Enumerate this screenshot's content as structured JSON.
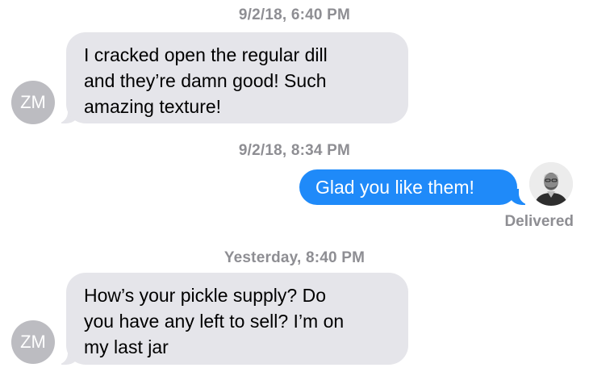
{
  "conversation": {
    "messages": [
      {
        "timestamp": "9/2/18, 6:40 PM",
        "sender_initials": "ZM",
        "lines": [
          "I cracked open the regular dill",
          "and they’re damn good! Such",
          "amazing texture!"
        ]
      },
      {
        "timestamp": "9/2/18, 8:34 PM",
        "text": "Glad you like them!",
        "status": "Delivered"
      },
      {
        "timestamp": "Yesterday, 8:40 PM",
        "sender_initials": "ZM",
        "lines": [
          "How’s your pickle supply? Do",
          "you have any left to sell? I’m on",
          "my last jar"
        ]
      }
    ]
  },
  "colors": {
    "incoming_bubble": "#e5e5ea",
    "outgoing_bubble": "#1f8af9",
    "timestamp_text": "#8e8e93",
    "avatar_initials_bg": "#bcbcc1"
  },
  "icons": {
    "sender_avatar": "initials-avatar",
    "self_avatar": "person-photo-avatar"
  }
}
